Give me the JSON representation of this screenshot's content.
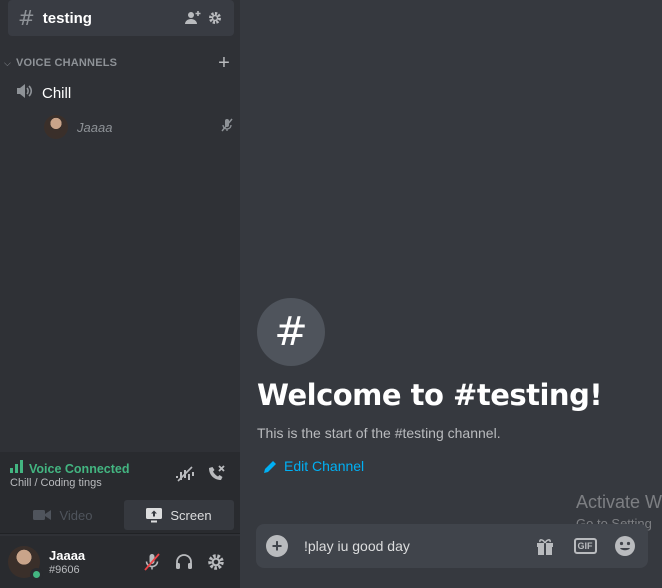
{
  "channel": {
    "hash": "#",
    "name": "testing"
  },
  "category": {
    "label": "VOICE CHANNELS",
    "add": "+"
  },
  "voice_channel": {
    "name": "Chill"
  },
  "voice_user": {
    "name": "Jaaaa"
  },
  "voice_panel": {
    "status": "Voice Connected",
    "sub": "Chill / Coding tings",
    "video_label": "Video",
    "screen_label": "Screen"
  },
  "user": {
    "name": "Jaaaa",
    "tag": "#9606",
    "status_color": "#43b581"
  },
  "welcome": {
    "icon": "#",
    "title": "Welcome to #testing!",
    "subtitle": "This is the start of the #testing channel.",
    "edit_label": "Edit Channel"
  },
  "watermark": {
    "title": "Activate W",
    "sub": "Go to Setting"
  },
  "composer": {
    "add": "+",
    "value": "!play iu good day",
    "gif_label": "GIF"
  },
  "colors": {
    "accent_green": "#43b581",
    "link_blue": "#00b0f4",
    "bg_main": "#36393f",
    "bg_sidebar": "#2f3136"
  }
}
